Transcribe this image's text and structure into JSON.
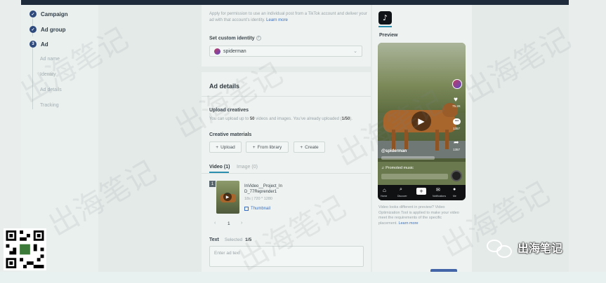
{
  "sidebar": {
    "items": [
      {
        "label": "Campaign",
        "state": "done"
      },
      {
        "label": "Ad group",
        "state": "done"
      },
      {
        "label": "Ad",
        "state": "current",
        "step": "3"
      }
    ],
    "subitems": [
      "Ad name",
      "Identity",
      "Ad details",
      "Tracking"
    ]
  },
  "identity": {
    "intro_line1": "Apply for permission to use an individual post from a TikTok account and deliver your",
    "intro_line2": "ad with that account’s identity.",
    "learn_more": "Learn more",
    "custom_identity_label": "Set custom identity",
    "selected_identity": "spiderman"
  },
  "ad_details": {
    "title": "Ad details",
    "upload_label": "Upload creatives",
    "upload_help_prefix": "You can upload up to",
    "upload_max": "50",
    "upload_help_mid": "videos and images. You’ve already uploaded (",
    "upload_count": "1/50",
    "upload_help_suffix": ").",
    "creative_materials_label": "Creative materials",
    "buttons": {
      "upload": "Upload",
      "library": "From library",
      "create": "Create"
    },
    "tabs": {
      "video": "Video (1)",
      "image": "Image (0)"
    },
    "video_item": {
      "index": "1",
      "name_line1": "InVideo__Project_In",
      "name_line2": "D_77Reprender1",
      "meta": "18s | 720 * 1280",
      "thumbnail_label": "Thumbnail"
    },
    "pagination": {
      "page": "1"
    },
    "text_label": "Text",
    "selected_label": "Selected",
    "selected_count": "1/5",
    "text_placeholder": "Enter ad text"
  },
  "preview": {
    "label": "Preview",
    "username": "@spiderman",
    "promoted": "Promoted music",
    "nav_labels": [
      "Home",
      "Discover",
      "",
      "Notifications",
      "Me"
    ],
    "side_counts": [
      "75.2K",
      "1357",
      "1357"
    ],
    "notice_line1": "Video looks different in preview? Video",
    "notice_line2": "Optimization Tool is applied to make your video",
    "notice_line3": "meet the requirements of the specific",
    "notice_line4": "placement.",
    "notice_link": "Learn more"
  },
  "watermark": {
    "text": "出海笔记",
    "brand": "出海笔记"
  },
  "colors": {
    "accent": "#2e4a7d",
    "topbar": "#1d2b3a",
    "video_bg": "#6b7a4e",
    "dog": "#a8662d"
  }
}
